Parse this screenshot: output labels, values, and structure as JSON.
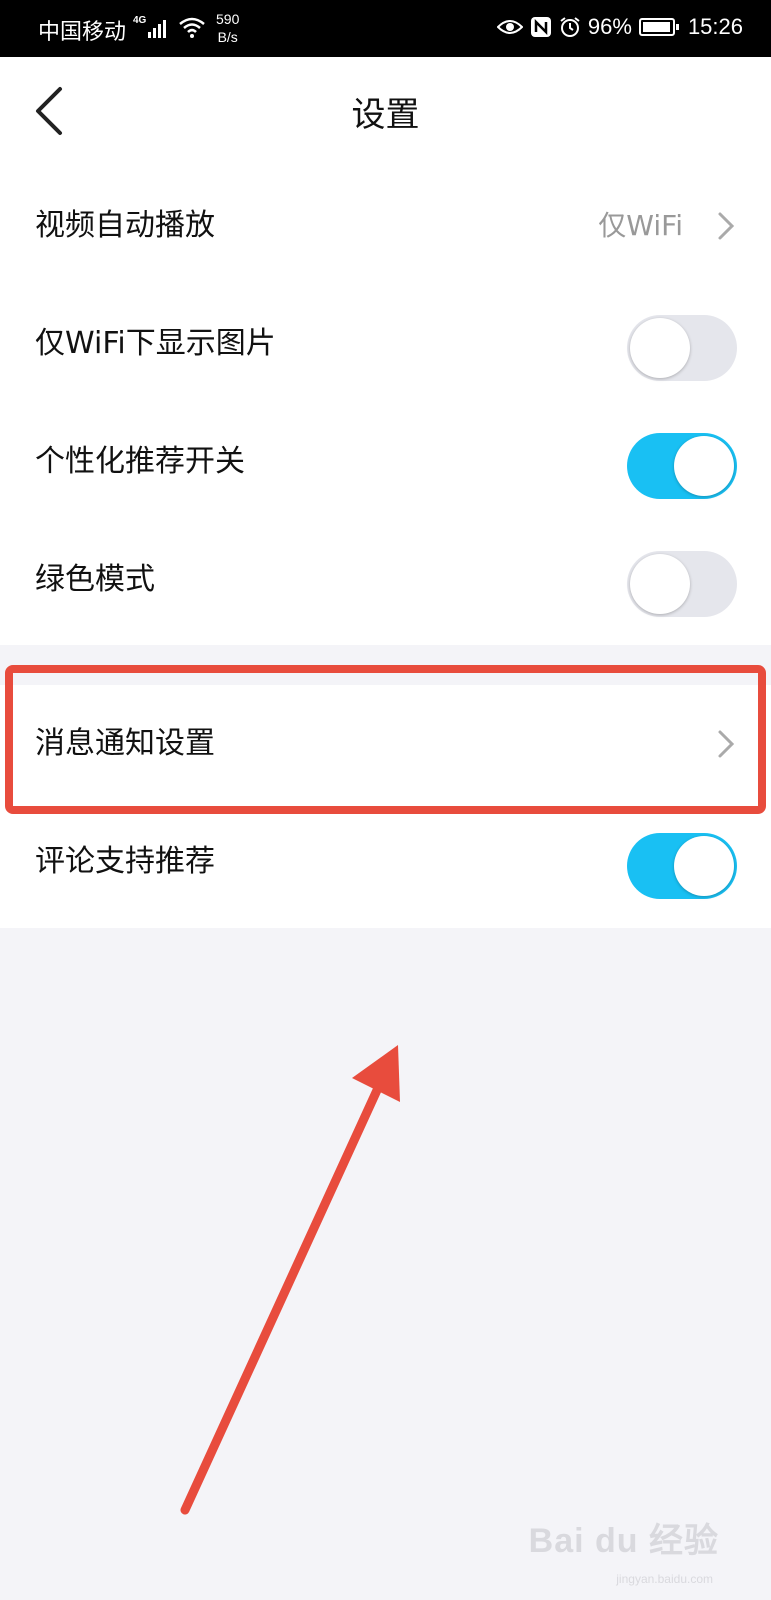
{
  "status_bar": {
    "carrier": "中国移动",
    "network_type": "4G",
    "speed_value": "590",
    "speed_unit": "B/s",
    "battery": "96%",
    "time": "15:26",
    "icons": [
      "signal-icon",
      "wifi-icon",
      "eye-icon",
      "nfc-icon",
      "alarm-icon",
      "battery-icon"
    ]
  },
  "header": {
    "title": "设置",
    "back_icon": "chevron-left-icon"
  },
  "settings_group1": [
    {
      "label": "视频自动播放",
      "type": "select",
      "value": "仅WiFi"
    },
    {
      "label": "仅WiFi下显示图片",
      "type": "toggle",
      "on": false
    },
    {
      "label": "个性化推荐开关",
      "type": "toggle",
      "on": true
    },
    {
      "label": "绿色模式",
      "type": "toggle",
      "on": false
    }
  ],
  "settings_group2": [
    {
      "label": "消息通知设置",
      "type": "link"
    },
    {
      "label": "评论支持推荐",
      "type": "toggle",
      "on": true
    }
  ],
  "annotation": {
    "highlight_color": "#e84c3d",
    "highlighted_item": "消息通知设置"
  },
  "colors": {
    "toggle_on": "#19c0f3",
    "toggle_off": "#e5e6ec",
    "page_bg": "#f4f4f8"
  },
  "watermark": {
    "text": "Bai du 经验",
    "sub": "jingyan.baidu.com"
  }
}
